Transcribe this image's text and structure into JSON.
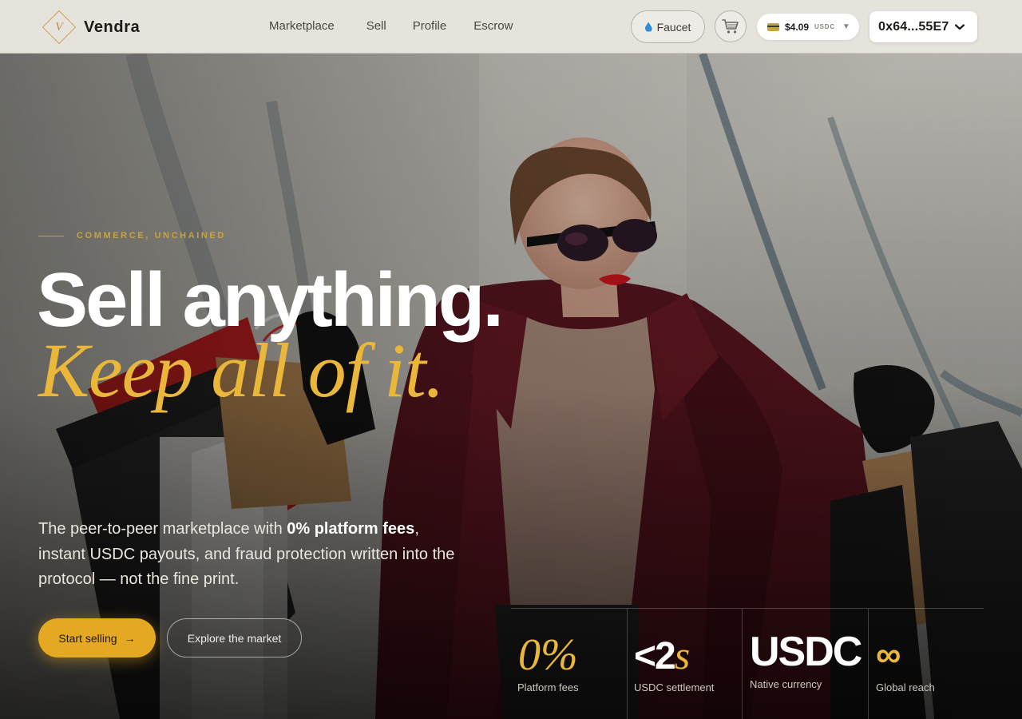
{
  "brand": {
    "name": "Vendra",
    "mark_letter": "V"
  },
  "nav": {
    "links": [
      "Marketplace",
      "Sell",
      "Profile",
      "Escrow"
    ],
    "faucet_label": "Faucet",
    "balance_amount": "$4.09",
    "balance_unit": "USDC",
    "wallet_address": "0x64...55E7"
  },
  "hero": {
    "eyebrow": "COMMERCE, UNCHAINED",
    "headline": "Sell anything.",
    "headline_accent": "Keep all of it.",
    "lead_pre": "The peer-to-peer marketplace with ",
    "lead_bold": "0% platform fees",
    "lead_post": ", instant USDC payouts, and fraud protection written into the protocol — not the fine print.",
    "primary_cta": "Start selling",
    "primary_cta_arrow": "→",
    "secondary_cta": "Explore the market"
  },
  "stats": [
    {
      "value": "0%",
      "label": "Platform fees"
    },
    {
      "value_main": "<2",
      "value_suffix": "s",
      "label": "USDC settlement"
    },
    {
      "value": "USDC",
      "label": "Native currency"
    },
    {
      "value": "∞",
      "label": "Global reach"
    }
  ],
  "colors": {
    "accent": "#e5a823",
    "gold_text": "#eab73a",
    "nav_bg": "#e6e3dc"
  }
}
